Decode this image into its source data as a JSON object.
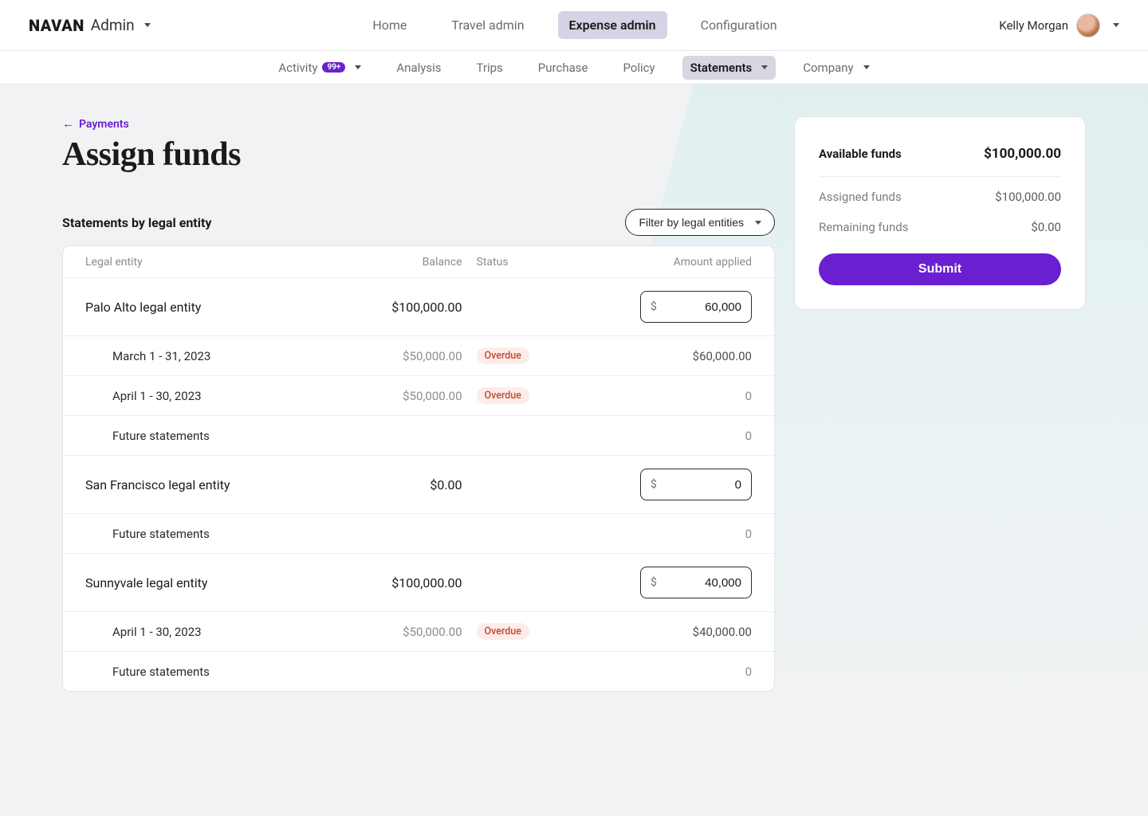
{
  "brand": {
    "logo": "NAVAN",
    "suffix": "Admin"
  },
  "topnav": {
    "items": [
      {
        "label": "Home",
        "active": false
      },
      {
        "label": "Travel admin",
        "active": false
      },
      {
        "label": "Expense admin",
        "active": true
      },
      {
        "label": "Configuration",
        "active": false
      }
    ]
  },
  "user": {
    "name": "Kelly Morgan"
  },
  "subnav": {
    "items": [
      {
        "label": "Activity",
        "badge": "99+",
        "caret": true,
        "active": false
      },
      {
        "label": "Analysis",
        "active": false
      },
      {
        "label": "Trips",
        "active": false
      },
      {
        "label": "Purchase",
        "active": false
      },
      {
        "label": "Policy",
        "active": false
      },
      {
        "label": "Statements",
        "caret": true,
        "active": true
      },
      {
        "label": "Company",
        "caret": true,
        "active": false
      }
    ]
  },
  "back_link": "Payments",
  "page_title": "Assign funds",
  "section_title": "Statements by legal entity",
  "filter_label": "Filter by legal entities",
  "table": {
    "headers": {
      "entity": "Legal entity",
      "balance": "Balance",
      "status": "Status",
      "amount": "Amount applied"
    },
    "entities": [
      {
        "name": "Palo Alto legal entity",
        "balance": "$100,000.00",
        "input_value": "60,000",
        "rows": [
          {
            "label": "March 1 - 31, 2023",
            "balance": "$50,000.00",
            "status": "Overdue",
            "applied": "$60,000.00"
          },
          {
            "label": "April 1 - 30, 2023",
            "balance": "$50,000.00",
            "status": "Overdue",
            "applied": "0"
          },
          {
            "label": "Future statements",
            "balance": "",
            "status": "",
            "applied": "0"
          }
        ]
      },
      {
        "name": "San Francisco legal entity",
        "balance": "$0.00",
        "input_value": "0",
        "rows": [
          {
            "label": "Future statements",
            "balance": "",
            "status": "",
            "applied": "0"
          }
        ]
      },
      {
        "name": "Sunnyvale legal entity",
        "balance": "$100,000.00",
        "input_value": "40,000",
        "rows": [
          {
            "label": "April 1 - 30, 2023",
            "balance": "$50,000.00",
            "status": "Overdue",
            "applied": "$40,000.00"
          },
          {
            "label": "Future statements",
            "balance": "",
            "status": "",
            "applied": "0"
          }
        ]
      }
    ]
  },
  "funds": {
    "available": {
      "label": "Available funds",
      "value": "$100,000.00"
    },
    "assigned": {
      "label": "Assigned funds",
      "value": "$100,000.00"
    },
    "remaining": {
      "label": "Remaining funds",
      "value": "$0.00"
    },
    "submit_label": "Submit"
  },
  "currency_prefix": "$"
}
